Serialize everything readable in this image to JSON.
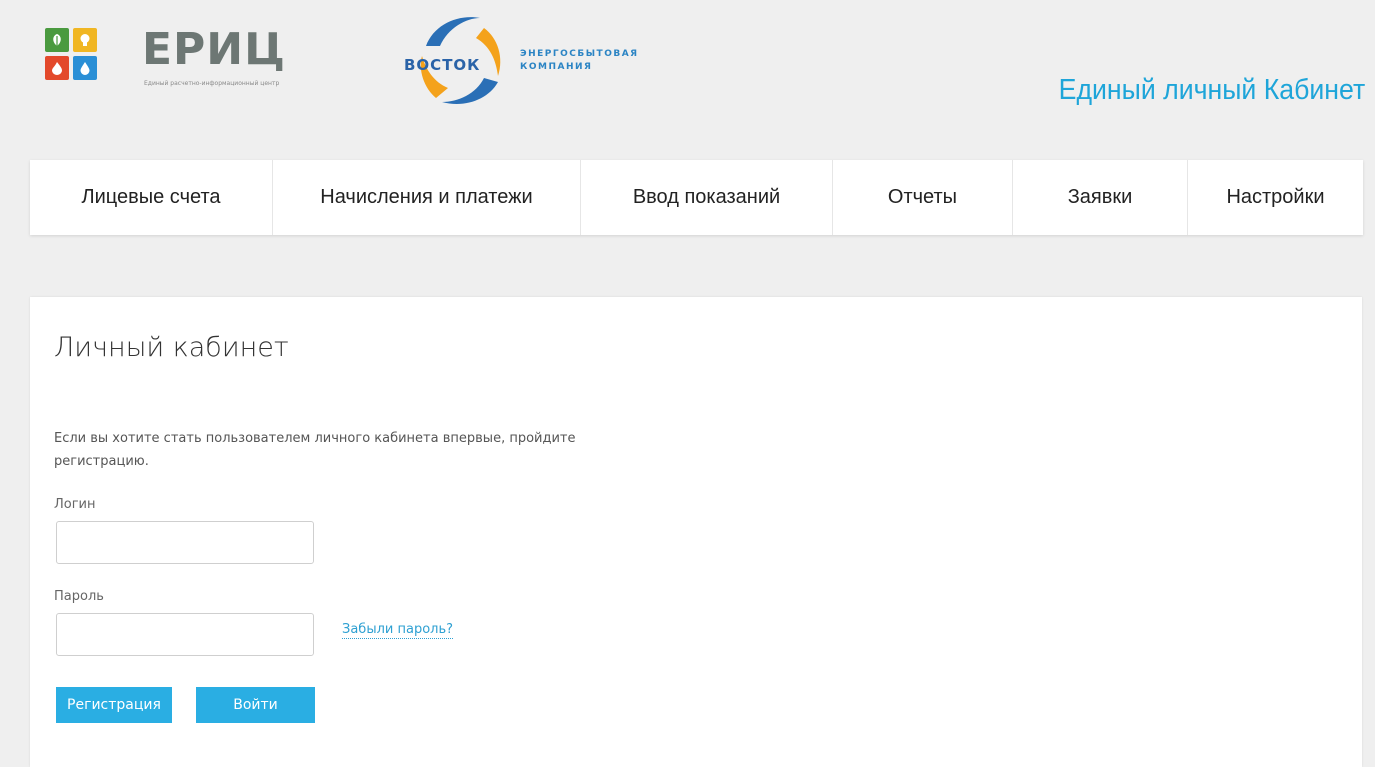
{
  "header": {
    "eric": {
      "name": "ЕРИЦ",
      "subtitle": "Единый расчетно-информационный центр"
    },
    "vostok": {
      "name": "ВОСТОК",
      "subtitle_line1": "ЭНЕРГОСБЫТОВАЯ",
      "subtitle_line2": "КОМПАНИЯ"
    },
    "site_title": "Единый личный Кабинет"
  },
  "nav": {
    "items": [
      {
        "label": "Лицевые счета"
      },
      {
        "label": "Начисления и платежи"
      },
      {
        "label": "Ввод показаний"
      },
      {
        "label": "Отчеты"
      },
      {
        "label": "Заявки"
      },
      {
        "label": "Настройки"
      }
    ]
  },
  "login": {
    "title": "Личный кабинет",
    "intro": "Если вы хотите стать пользователем личного кабинета впервые, пройдите регистрацию.",
    "login_label": "Логин",
    "login_value": "",
    "password_label": "Пароль",
    "password_value": "",
    "forgot_label": "Забыли пароль?",
    "register_label": "Регистрация",
    "submit_label": "Войти"
  },
  "colors": {
    "accent": "#2aaee3",
    "title": "#1ea5d9",
    "tile_green": "#4a9a3f",
    "tile_yellow": "#f0b623",
    "tile_red": "#e3492b",
    "tile_blue": "#2a8fd6"
  },
  "icons": [
    "leaf-icon",
    "bulb-icon",
    "flame-icon",
    "water-drop-icon",
    "vostok-swirl-icon"
  ]
}
